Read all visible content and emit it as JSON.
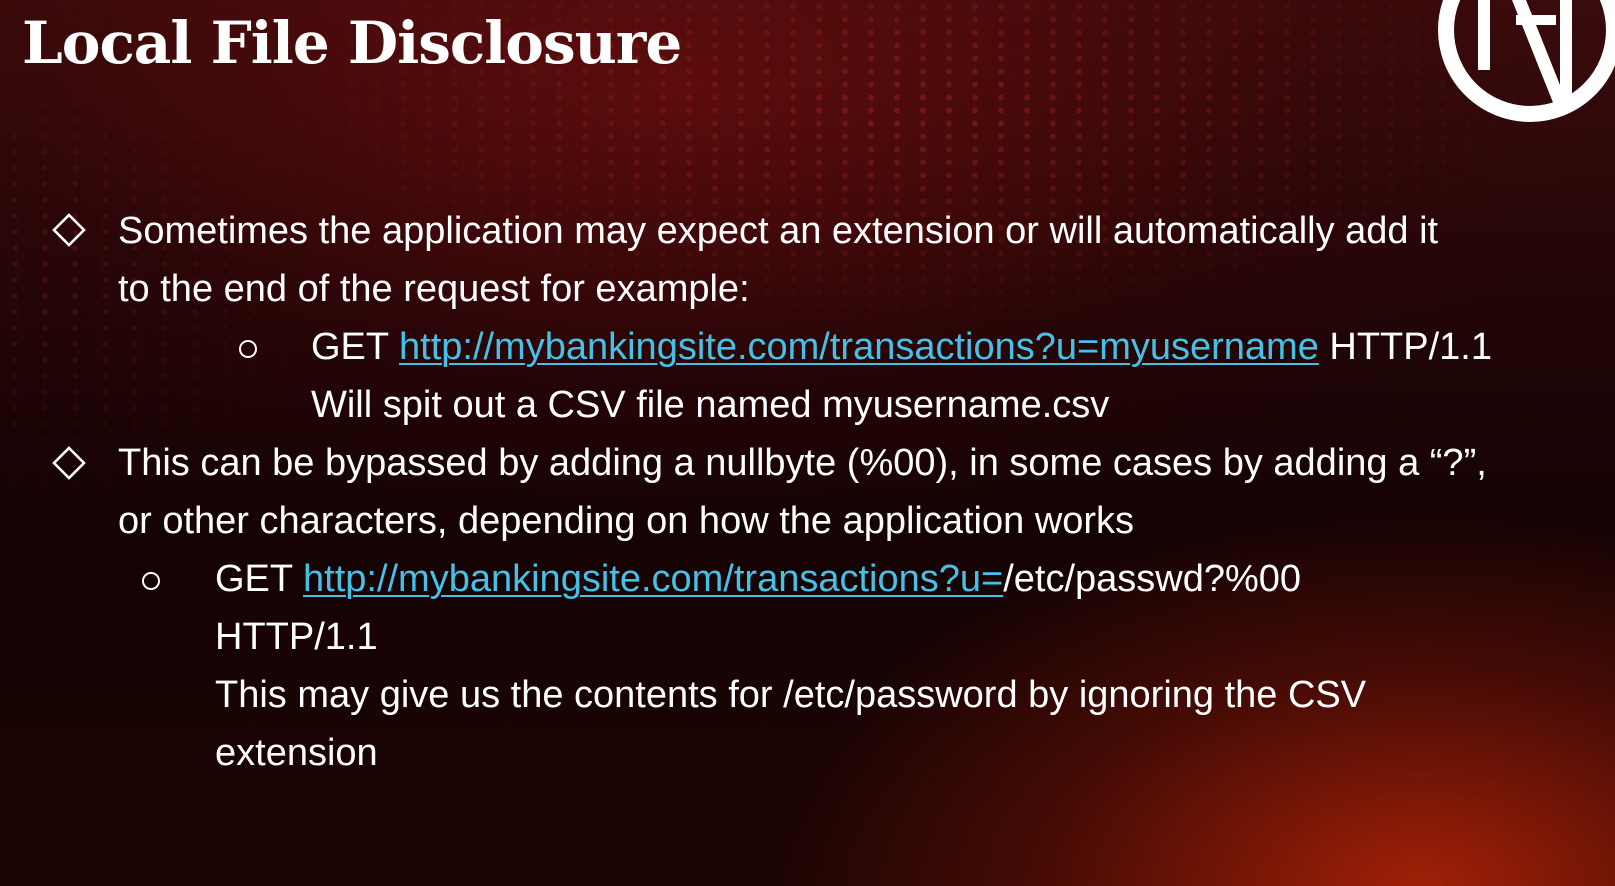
{
  "slide": {
    "title": "Local File Disclosure",
    "bullets": [
      {
        "lines": [
          "Sometimes the application may expect an extension or will automatically add it",
          "to the end of the request for example:"
        ],
        "sub": {
          "method": "GET",
          "url": "http://mybankingsite.com/transactions?u=myusername",
          "suffix": "HTTP/1.1",
          "note": "Will spit out a CSV file named myusername.csv"
        }
      },
      {
        "lines": [
          "This can be bypassed by adding a nullbyte (%00), in some cases by adding a “?”,",
          "or other characters, depending on how the application works"
        ],
        "sub": {
          "method": "GET",
          "url": "http://mybankingsite.com/transactions?u=",
          "suffix": "/etc/passwd?%00",
          "line2": "HTTP/1.1",
          "note_lines": [
            "This may give us the contents for /etc/password by ignoring the CSV",
            "extension"
          ]
        }
      }
    ]
  },
  "colors": {
    "link": "#45c1e8",
    "text": "#ffffff",
    "accent_glow": "#be2608"
  },
  "icons": {
    "bullet_level1": "diamond-outline",
    "bullet_level2": "circle-outline",
    "logo": "circular-monogram-logo"
  }
}
